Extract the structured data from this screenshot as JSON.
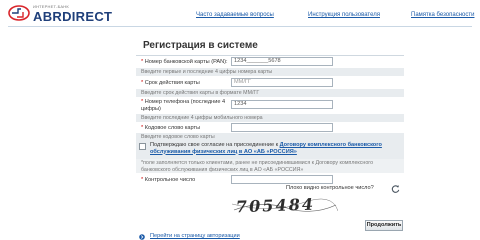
{
  "header": {
    "logo_sub": "ИНТЕРНЕТ-БАНК",
    "logo_name": "ABRDIRECT",
    "links": [
      {
        "label": "Часто задаваемые вопросы"
      },
      {
        "label": "Инструкция пользователя"
      },
      {
        "label": "Памятка безопасности"
      }
    ]
  },
  "title": "Регистрация в системе",
  "fields": {
    "card_number": {
      "label": "Номер банковской карты (PAN):",
      "value": "1234_______5678",
      "hint": "Введите первые и последние 4 цифры номера карты"
    },
    "card_expiry": {
      "label": "Срок действия карты",
      "value": "ММ/ГГ",
      "hint": "Введите срок действия карты в формате ММ/ГГ"
    },
    "phone": {
      "label": "Номер телефона (последние 4 цифры)",
      "value": "1234",
      "hint": "Введите последние 4 цифры мобильного номера"
    },
    "code_word": {
      "label": "Кодовое слово карты",
      "value": "",
      "hint": "Введите кодовое слово карты"
    }
  },
  "required_mark": "*",
  "consent": {
    "text_before": "Подтверждаю свое согласие на присоединение к ",
    "link": "Договору комплексного банковского обслуживания физических лиц в АО «АБ «РОССИЯ»"
  },
  "note": "*поле заполняется только клиентами, ранее не присоединившимися к Договору комплексного банковского обслуживания физических лиц в АО «АБ «РОССИЯ»",
  "control_number": {
    "label": "Контрольное число",
    "value": ""
  },
  "captcha": {
    "question": "Плохо видно контрольное число?",
    "text": "705484",
    "refresh_icon": "refresh-icon"
  },
  "submit_label": "Продолжить",
  "back_link": "Перейти на страницу авторизации",
  "colors": {
    "link": "#1a5aa8",
    "brand": "#1f3f7a",
    "logo_red": "#d9252b",
    "hint_bg": "#e8ecef"
  }
}
